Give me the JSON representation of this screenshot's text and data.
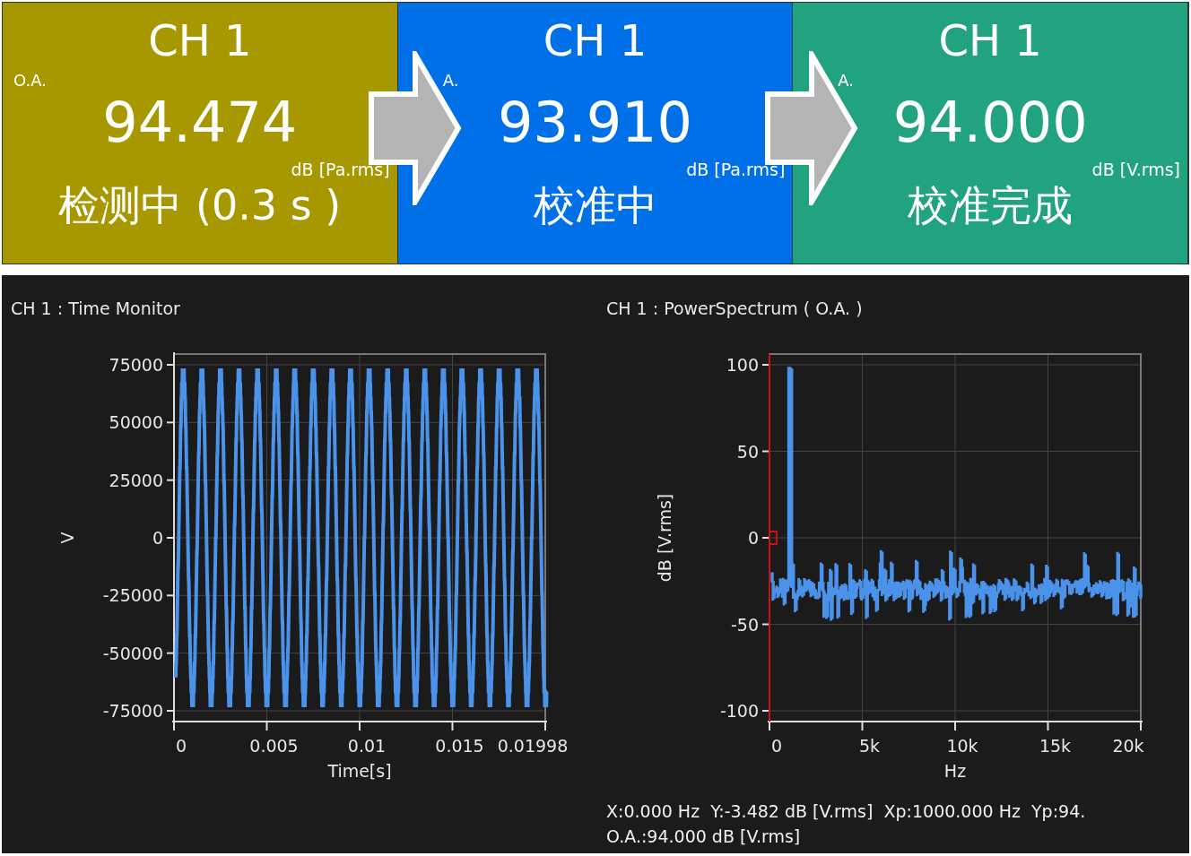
{
  "status_panels": [
    {
      "title": "CH 1",
      "label": "O.A.",
      "value": "94.474",
      "unit": "dB [Pa.rms]",
      "status": "检测中 (0.3 s )",
      "color": "#a89800"
    },
    {
      "title": "CH 1",
      "label": "A.",
      "value": "93.910",
      "unit": "dB [Pa.rms]",
      "status": "校准中",
      "color": "#0070e8"
    },
    {
      "title": "CH 1",
      "label": "A.",
      "value": "94.000",
      "unit": "dB [V.rms]",
      "status": "校准完成",
      "color": "#22a37f"
    }
  ],
  "charts": [
    {
      "kind": "time",
      "title": "CH 1 : Time Monitor",
      "ylabel": "V",
      "yticks": [
        "75000",
        "50000",
        "25000",
        "0",
        "-25000",
        "-50000",
        "-75000"
      ],
      "xlabel": "Time[s]",
      "xticks": [
        "0",
        "0.005",
        "0.01",
        "0.015",
        "0.01998"
      ]
    },
    {
      "kind": "spectrum",
      "title": "CH 1 : PowerSpectrum ( O.A. )",
      "ylabel": "dB [V.rms]",
      "yticks": [
        "100",
        "50",
        "0",
        "-50",
        "-100"
      ],
      "xlabel": "Hz",
      "xticks": [
        "0",
        "5k",
        "10k",
        "15k",
        "20k"
      ],
      "readout": [
        "X:0.000 Hz  Y:-3.482 dB [V.rms]  Xp:1000.000 Hz  Yp:94.",
        "O.A.:94.000 dB [V.rms]"
      ]
    }
  ]
}
